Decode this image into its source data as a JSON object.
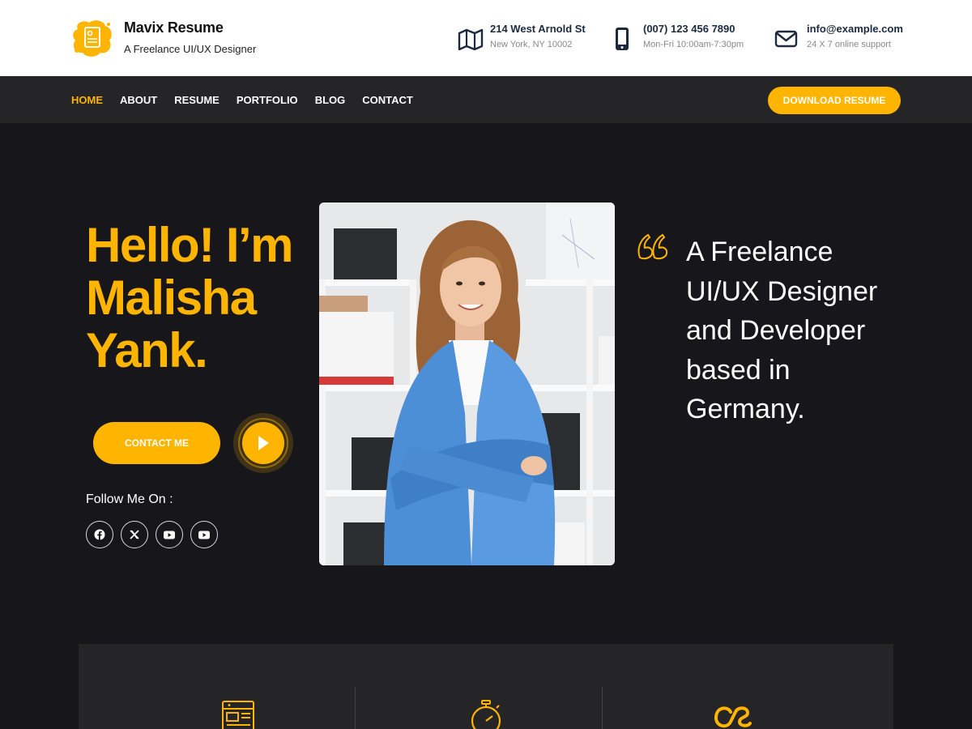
{
  "site": {
    "title": "Mavix Resume",
    "tagline": "A Freelance UI/UX Designer"
  },
  "contacts": [
    {
      "icon": "map-icon",
      "main": "214 West Arnold St",
      "sub": "New York, NY 10002"
    },
    {
      "icon": "phone-icon",
      "main": "(007) 123 456 7890",
      "sub": "Mon-Fri 10:00am-7:30pm"
    },
    {
      "icon": "envelope-icon",
      "main": "info@example.com",
      "sub": "24 X 7 online support"
    }
  ],
  "nav": {
    "items": [
      "HOME",
      "ABOUT",
      "RESUME",
      "PORTFOLIO",
      "BLOG",
      "CONTACT"
    ],
    "active": "HOME",
    "download_label": "DOWNLOAD RESUME"
  },
  "hero": {
    "title": "Hello! I’m Malisha Yank.",
    "contact_label": "CONTACT ME",
    "follow_label": "Follow Me On :",
    "socials": [
      "facebook-icon",
      "x-icon",
      "youtube-icon",
      "youtube-icon"
    ],
    "quote": "A Freelance UI/UX Designer and Developer based in Germany."
  },
  "services": {
    "icons": [
      "resume-icon",
      "stopwatch-icon",
      "lastfm-icon"
    ]
  },
  "colors": {
    "accent": "#ffb400",
    "dark_bg": "#17161b",
    "nav_bg": "#252528",
    "heading_dark": "#1b2a3f"
  }
}
